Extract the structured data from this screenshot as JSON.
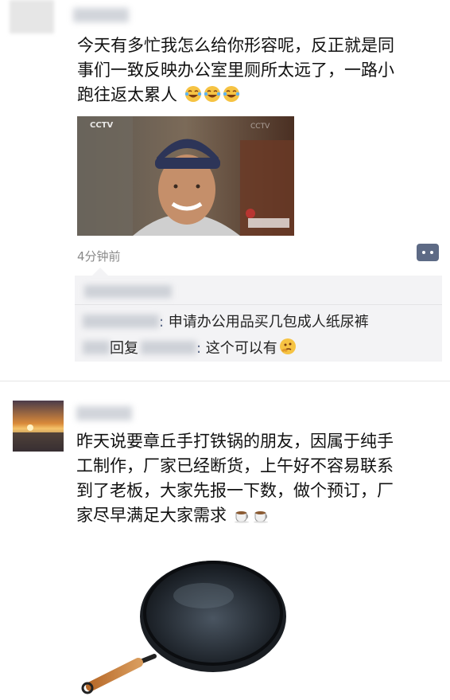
{
  "posts": [
    {
      "text_line1": "今天有多忙我怎么给你形容呢，反正就是同",
      "text_line2": "事们一致反映办公室里厕所太远了，一路小",
      "text_line3": "跑往返太累人",
      "emojis": [
        "laugh-cry-emoji",
        "laugh-cry-emoji",
        "laugh-cry-emoji"
      ],
      "video": {
        "watermark_left": "CCTV",
        "watermark_right": "CCTV"
      },
      "time": "4分钟前",
      "comments": [
        {
          "text": "申请办公用品买几包成人纸尿裤"
        },
        {
          "reply_label": "回复",
          "text": "这个可以有"
        }
      ]
    },
    {
      "text_line1": "昨天说要章丘手打铁锅的朋友，因属于纯手",
      "text_line2": "工制作，厂家已经断货，上午好不容易联系",
      "text_line3": "到了老板，大家先报一下数，做个预订，厂",
      "text_line4": "家尽早满足大家需求",
      "emojis": [
        "coffee-emoji",
        "coffee-emoji"
      ]
    }
  ],
  "colors": {
    "link_name": "#4b5a7d",
    "more_button": "#5d6a85",
    "comment_bg": "#f3f3f5"
  }
}
